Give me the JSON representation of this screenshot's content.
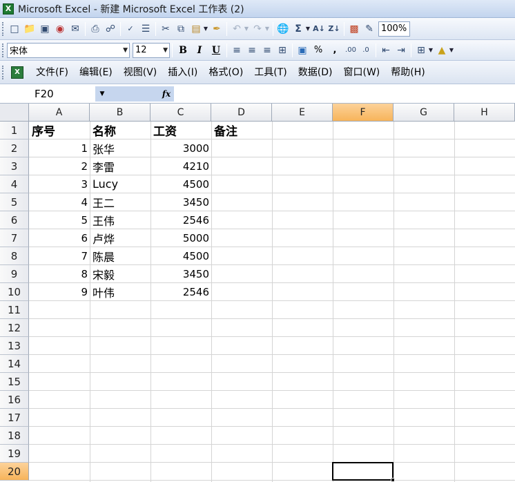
{
  "window": {
    "title": "Microsoft Excel - 新建 Microsoft Excel 工作表 (2)",
    "app_icon": "excel-icon"
  },
  "toolbar_standard": {
    "buttons": [
      "new-icon",
      "open-icon",
      "save-icon",
      "permission-icon",
      "email-icon",
      "print-icon",
      "print-preview-icon",
      "spelling-icon",
      "research-icon",
      "cut-icon",
      "copy-icon",
      "paste-icon",
      "format-painter-icon",
      "undo-icon",
      "redo-icon",
      "hyperlink-icon",
      "autosum-icon",
      "sort-ascending-icon",
      "sort-descending-icon",
      "chart-wizard-icon",
      "drawing-icon"
    ],
    "zoom": "100%"
  },
  "toolbar_formatting": {
    "font_name": "宋体",
    "font_size": "12",
    "bold": "B",
    "italic": "I",
    "underline": "U",
    "percent": "%",
    "comma": ","
  },
  "menu": {
    "items": [
      "文件(F)",
      "编辑(E)",
      "视图(V)",
      "插入(I)",
      "格式(O)",
      "工具(T)",
      "数据(D)",
      "窗口(W)",
      "帮助(H)"
    ]
  },
  "formula_bar": {
    "name_box": "F20",
    "fx_label": "fx",
    "formula": ""
  },
  "sheet": {
    "columns": [
      "A",
      "B",
      "C",
      "D",
      "E",
      "F",
      "G",
      "H"
    ],
    "active_column": "F",
    "rows": [
      "1",
      "2",
      "3",
      "4",
      "5",
      "6",
      "7",
      "8",
      "9",
      "10",
      "11",
      "12",
      "13",
      "14",
      "15",
      "16",
      "17",
      "18",
      "19",
      "20"
    ],
    "active_row": "20",
    "header_row": {
      "A": "序号",
      "B": "名称",
      "C": "工资",
      "D": "备注"
    },
    "data": [
      {
        "seq": "1",
        "name": "张华",
        "salary": "3000"
      },
      {
        "seq": "2",
        "name": "李雷",
        "salary": "4210"
      },
      {
        "seq": "3",
        "name": "Lucy",
        "salary": "4500"
      },
      {
        "seq": "4",
        "name": "王二",
        "salary": "3450"
      },
      {
        "seq": "5",
        "name": "王伟",
        "salary": "2546"
      },
      {
        "seq": "6",
        "name": "卢烨",
        "salary": "5000"
      },
      {
        "seq": "7",
        "name": "陈晨",
        "salary": "4500"
      },
      {
        "seq": "8",
        "name": "宋毅",
        "salary": "3450"
      },
      {
        "seq": "9",
        "name": "叶伟",
        "salary": "2546"
      }
    ]
  }
}
